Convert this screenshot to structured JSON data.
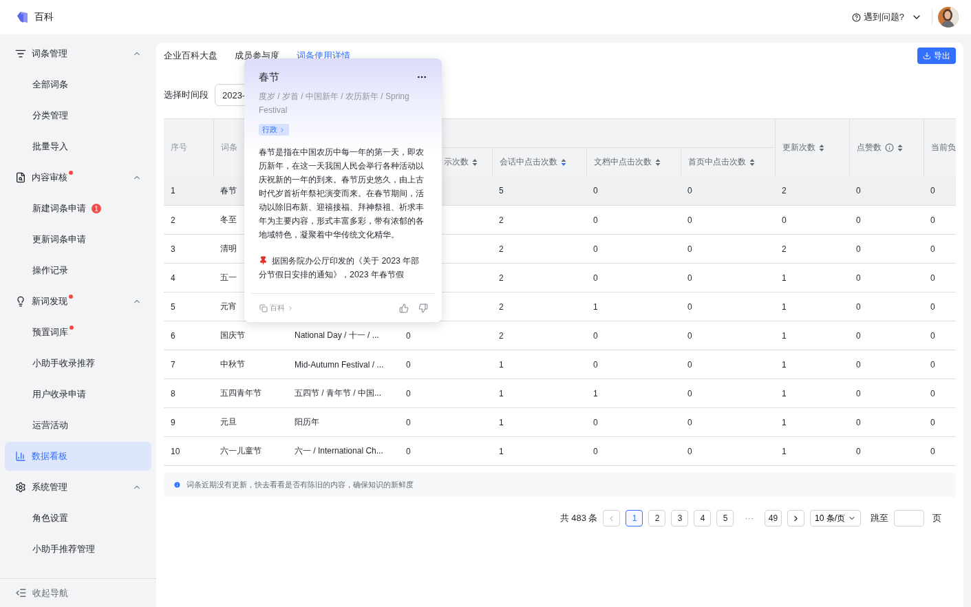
{
  "top_bar": {
    "app_name": "百科",
    "help": "遇到问题?"
  },
  "sidebar": {
    "items": [
      {
        "kind": "group",
        "label": "词条管理",
        "expanded": true,
        "dot": false,
        "selected": false,
        "children": [
          {
            "label": "全部词条",
            "selected": false,
            "dot": false
          },
          {
            "label": "分类管理",
            "selected": false,
            "dot": false
          },
          {
            "label": "批量导入",
            "selected": false,
            "dot": false
          }
        ]
      },
      {
        "kind": "group",
        "label": "内容审核",
        "expanded": true,
        "dot": true,
        "selected": false,
        "children": [
          {
            "label": "新建词条申请",
            "selected": false,
            "dot": false,
            "badge": "1"
          },
          {
            "label": "更新词条申请",
            "selected": false,
            "dot": false
          },
          {
            "label": "操作记录",
            "selected": false,
            "dot": false
          }
        ]
      },
      {
        "kind": "group",
        "label": "新词发现",
        "expanded": true,
        "dot": true,
        "selected": false,
        "children": [
          {
            "label": "预置词库",
            "selected": false,
            "dot": true
          },
          {
            "label": "小助手收录推荐",
            "selected": false,
            "dot": false
          },
          {
            "label": "用户收录申请",
            "selected": false,
            "dot": false
          },
          {
            "label": "运营活动",
            "selected": false,
            "dot": false
          }
        ]
      },
      {
        "kind": "link",
        "label": "数据看板",
        "dot": false,
        "selected": true
      },
      {
        "kind": "group",
        "label": "系统管理",
        "expanded": true,
        "dot": false,
        "selected": false,
        "children": [
          {
            "label": "角色设置",
            "selected": false,
            "dot": false
          },
          {
            "label": "小助手推荐管理",
            "selected": false,
            "dot": false
          }
        ]
      }
    ],
    "footer": "收起导航"
  },
  "tabs": [
    {
      "label": "企业百科大盘",
      "selected": false
    },
    {
      "label": "成员参与度",
      "selected": false
    },
    {
      "label": "词条使用详情",
      "selected": true
    }
  ],
  "export_button": "导出",
  "filter": {
    "label": "选择时间段",
    "value": "2023-"
  },
  "table": {
    "columns": [
      {
        "label": "序号"
      },
      {
        "label": "词条"
      },
      null,
      {
        "label": "示次数",
        "sortable": true,
        "sorted": false
      },
      {
        "label": "会话中点击次数",
        "sortable": true,
        "sorted": true
      },
      {
        "label": "文档中点击次数",
        "sortable": true,
        "sorted": false
      },
      {
        "label": "首页中点击次数",
        "sortable": true,
        "sorted": false
      },
      {
        "label": "更新次数",
        "sortable": true,
        "sorted": false
      },
      {
        "label": "点赞数",
        "sortable": true,
        "sorted": false,
        "info": true
      },
      {
        "label": "当前负"
      }
    ],
    "rows": [
      {
        "hovered": true,
        "cells": [
          "1",
          "春节",
          null,
          null,
          "5",
          "0",
          "0",
          "2",
          "0",
          "0"
        ]
      },
      {
        "hovered": false,
        "cells": [
          "2",
          "冬至",
          null,
          null,
          "2",
          "0",
          "0",
          "0",
          "0",
          "0"
        ]
      },
      {
        "hovered": false,
        "cells": [
          "3",
          "清明",
          null,
          null,
          "2",
          "0",
          "0",
          "2",
          "0",
          "0"
        ]
      },
      {
        "hovered": false,
        "cells": [
          "4",
          "五一",
          null,
          null,
          "2",
          "0",
          "0",
          "1",
          "0",
          "0"
        ]
      },
      {
        "hovered": false,
        "cells": [
          "5",
          "元宵",
          null,
          null,
          "2",
          "1",
          "0",
          "1",
          "0",
          "0"
        ]
      },
      {
        "hovered": false,
        "cells": [
          "6",
          "国庆节",
          "National Day / 十一 / ...",
          "0",
          "2",
          "0",
          "0",
          "1",
          "0",
          "0"
        ]
      },
      {
        "hovered": false,
        "cells": [
          "7",
          "中秋节",
          "Mid-Autumn Festival / ...",
          "0",
          "1",
          "0",
          "0",
          "1",
          "0",
          "0"
        ]
      },
      {
        "hovered": false,
        "cells": [
          "8",
          "五四青年节",
          "五四节 / 青年节 / 中国...",
          "0",
          "1",
          "1",
          "0",
          "1",
          "0",
          "0"
        ]
      },
      {
        "hovered": false,
        "cells": [
          "9",
          "元旦",
          "阳历年",
          "0",
          "1",
          "0",
          "0",
          "1",
          "0",
          "0"
        ]
      },
      {
        "hovered": false,
        "cells": [
          "10",
          "六一儿童节",
          "六一 / International Ch...",
          "0",
          "1",
          "0",
          "0",
          "1",
          "0",
          "0"
        ]
      }
    ]
  },
  "notice": "词条近期没有更新，快去看看是否有陈旧的内容，确保知识的新鲜度",
  "pagination": {
    "total": "共 483 条",
    "pages": [
      {
        "kind": "page",
        "label": "1",
        "selected": true
      },
      {
        "kind": "page",
        "label": "2",
        "selected": false
      },
      {
        "kind": "page",
        "label": "3",
        "selected": false
      },
      {
        "kind": "page",
        "label": "4",
        "selected": false
      },
      {
        "kind": "page",
        "label": "5",
        "selected": false
      },
      {
        "kind": "ellipsis",
        "label": "···"
      },
      {
        "kind": "page",
        "label": "49",
        "selected": false
      }
    ],
    "page_size": "10 条/页",
    "jump_label": "跳至",
    "page_unit": "页"
  },
  "popover": {
    "title": "春节",
    "aliases": "度岁 / 岁首 / 中国新年 / 农历新年 / Spring Festival",
    "tag": "行政",
    "description": "春节是指在中国农历中每一年的第一天，即农历新年，在这一天我国人民会举行各种活动以庆祝新的一年的到来。春节历史悠久，由上古时代岁首祈年祭祀演变而来。在春节期间，活动以除旧布新、迎禧接福、拜神祭祖、祈求丰年为主要内容，形式丰富多彩，带有浓郁的各地域特色，凝聚着中华传统文化精华。",
    "note": "据国务院办公厅印发的《关于 2023 年部分节假日安排的通知》，2023 年春节假",
    "source": "百科"
  }
}
